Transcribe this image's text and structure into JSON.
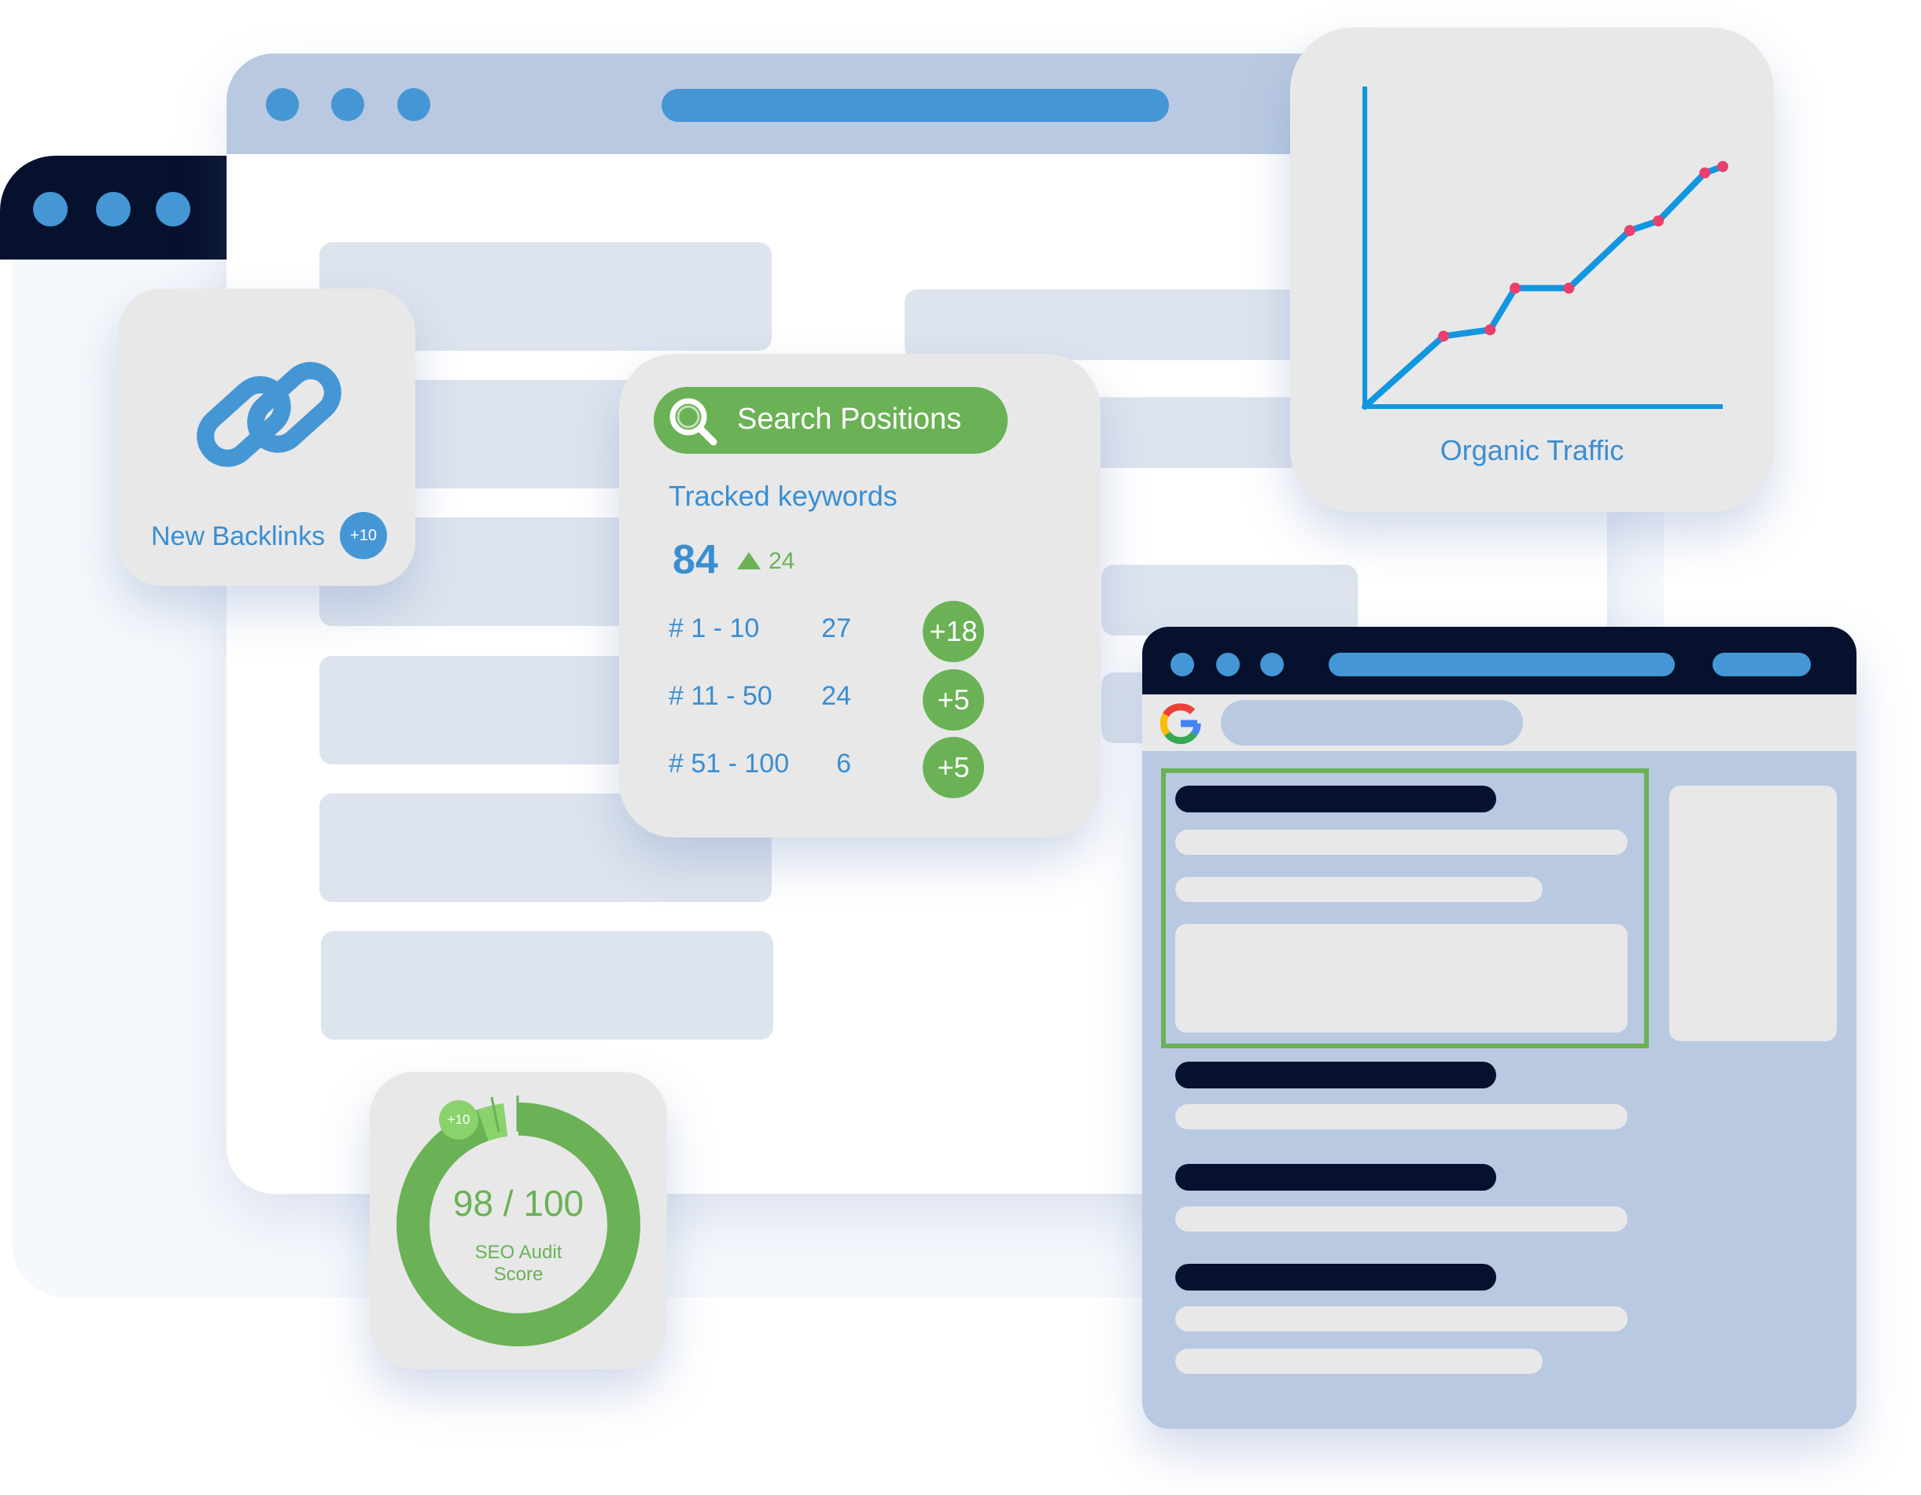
{
  "colors": {
    "blue_accent": "#4596d4",
    "navy": "#06112e",
    "green": "#6ab255",
    "chart_line": "#1296e0",
    "chart_point": "#e8406c",
    "card_bg": "#e8e8e9",
    "placeholder": "#dde4ee",
    "serp_bg": "#b9c9e1"
  },
  "backlinks_card": {
    "icon": "link-icon",
    "label": "New Backlinks",
    "badge": "+10"
  },
  "search_positions_card": {
    "button_label": "Search Positions",
    "button_icon": "search-icon",
    "tracked_label": "Tracked keywords",
    "total": "84",
    "change_icon": "triangle-up-icon",
    "change": "24",
    "rows": [
      {
        "range": "# 1 - 10",
        "count": "27",
        "delta": "+18"
      },
      {
        "range": "# 11 - 50",
        "count": "24",
        "delta": "+5"
      },
      {
        "range": "# 51 - 100",
        "count": "6",
        "delta": "+5"
      }
    ]
  },
  "traffic_card": {
    "label": "Organic Traffic"
  },
  "chart_data": {
    "type": "line",
    "title": "",
    "xlabel": "Organic Traffic",
    "ylabel": "",
    "series": [
      {
        "values": [
          0,
          22,
          24,
          37,
          37,
          55,
          58,
          73,
          75
        ]
      }
    ],
    "x": [
      0,
      22,
      35,
      42,
      57,
      74,
      82,
      95,
      100
    ],
    "xlim": [
      0,
      100
    ],
    "ylim": [
      0,
      100
    ],
    "grid": false
  },
  "audit_card": {
    "score": "98 / 100",
    "label_line1": "SEO Audit",
    "label_line2": "Score",
    "badge": "+10",
    "score_fraction": 0.98,
    "gain_fraction": 0.1
  },
  "serp_window": {
    "search_logo": "google-logo-icon"
  }
}
